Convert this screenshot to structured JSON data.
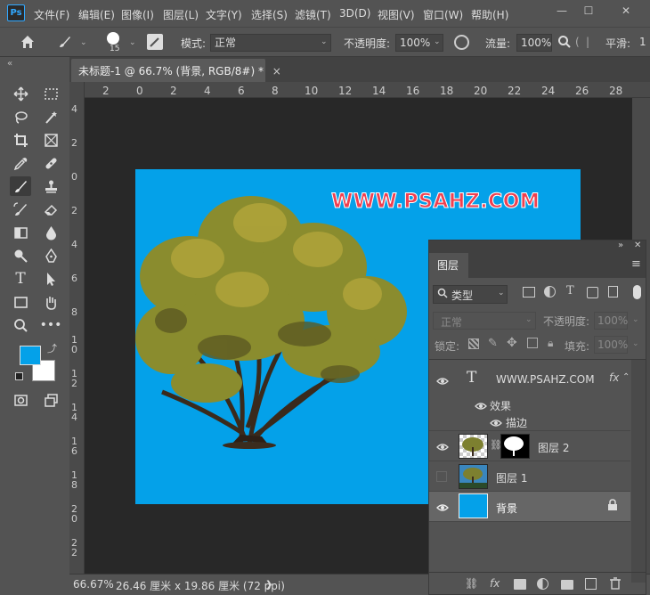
{
  "app": {
    "logo": "Ps"
  },
  "menu": [
    "文件(F)",
    "编辑(E)",
    "图像(I)",
    "图层(L)",
    "文字(Y)",
    "选择(S)",
    "滤镜(T)",
    "3D(D)",
    "视图(V)",
    "窗口(W)",
    "帮助(H)"
  ],
  "window_controls": {
    "minimize": "—",
    "restore": "☐",
    "close": "✕"
  },
  "options": {
    "brush_size": "15",
    "mode_label": "模式:",
    "mode_value": "正常",
    "opacity_label": "不透明度:",
    "opacity_value": "100%",
    "flow_label": "流量:",
    "flow_value": "100%",
    "smooth_label": "平滑:",
    "smooth_value": "1"
  },
  "document": {
    "tab_title": "未标题-1 @ 66.7% (背景, RGB/8#) *",
    "close_symbol": "×",
    "ruler_top": [
      "2",
      "0",
      "2",
      "4",
      "6",
      "8",
      "10",
      "12",
      "14",
      "16",
      "18",
      "20",
      "22",
      "24",
      "26",
      "28"
    ],
    "ruler_left": [
      "4",
      "2",
      "0",
      "2",
      "4",
      "6",
      "8",
      "1\n0",
      "1\n2",
      "1\n4",
      "1\n6",
      "1\n8",
      "2\n0",
      "2\n2"
    ],
    "watermark": "WWW.PSAHZ.COM",
    "canvas_color": "#04a1e9"
  },
  "status": {
    "zoom": "66.67%",
    "doc_size": "26.46 厘米 x 19.86 厘米 (72 ppi)",
    "arrow": "❯"
  },
  "layers_panel": {
    "tab_label": "图层",
    "filter_label": "类型",
    "blend_mode": "正常",
    "opacity_label": "不透明度:",
    "opacity_value": "100%",
    "lock_label": "锁定:",
    "fill_label": "填充:",
    "fill_value": "100%",
    "layers": [
      {
        "name": "WWW.PSAHZ.COM",
        "type": "text",
        "fx": "fx",
        "effects_label": "效果",
        "effect_name": "描边"
      },
      {
        "name": "图层 2",
        "type": "masked"
      },
      {
        "name": "图层 1",
        "type": "image"
      },
      {
        "name": "背景",
        "type": "background"
      }
    ]
  }
}
